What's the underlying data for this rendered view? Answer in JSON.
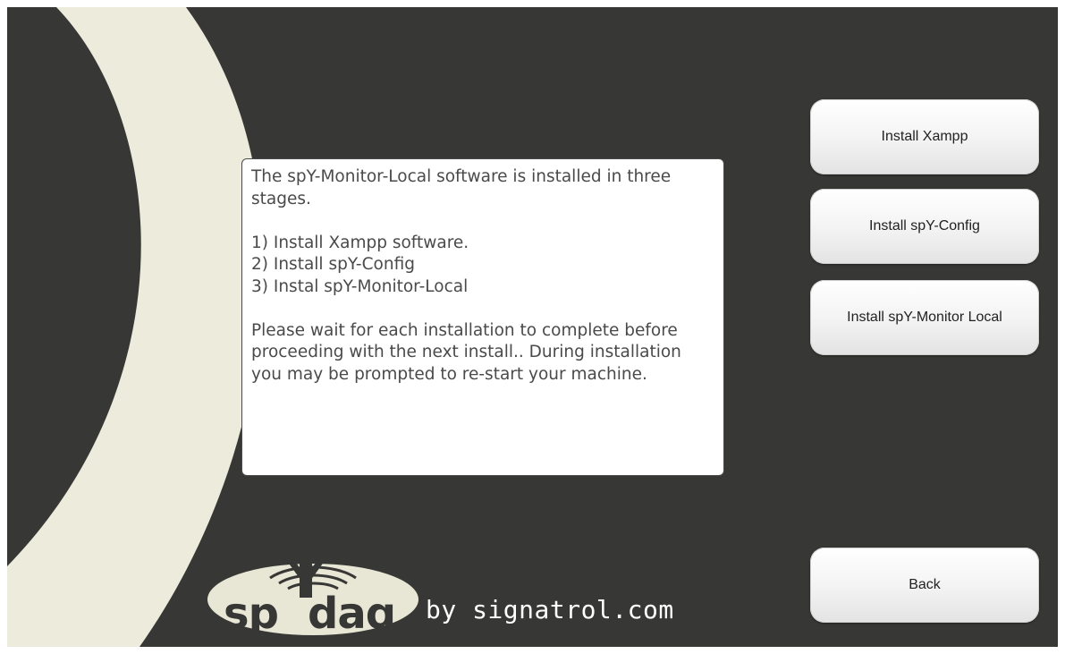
{
  "info": {
    "text": "The spY-Monitor-Local software is installed in three stages.\n\n1) Install Xampp software.\n2) Install spY-Config\n3) Instal spY-Monitor-Local\n\nPlease wait for each installation to complete before proceeding with the next install.. During installation you may be prompted to re-start your machine."
  },
  "buttons": {
    "install_xampp": "Install Xampp",
    "install_config": "Install spY-Config",
    "install_monitor": "Install spY-Monitor Local",
    "back": "Back"
  },
  "branding": {
    "logo_text": "spYdaq",
    "byline": "by signatrol.com"
  },
  "colors": {
    "background": "#373735",
    "swoosh": "#ecebdc",
    "button_text": "#222222"
  }
}
